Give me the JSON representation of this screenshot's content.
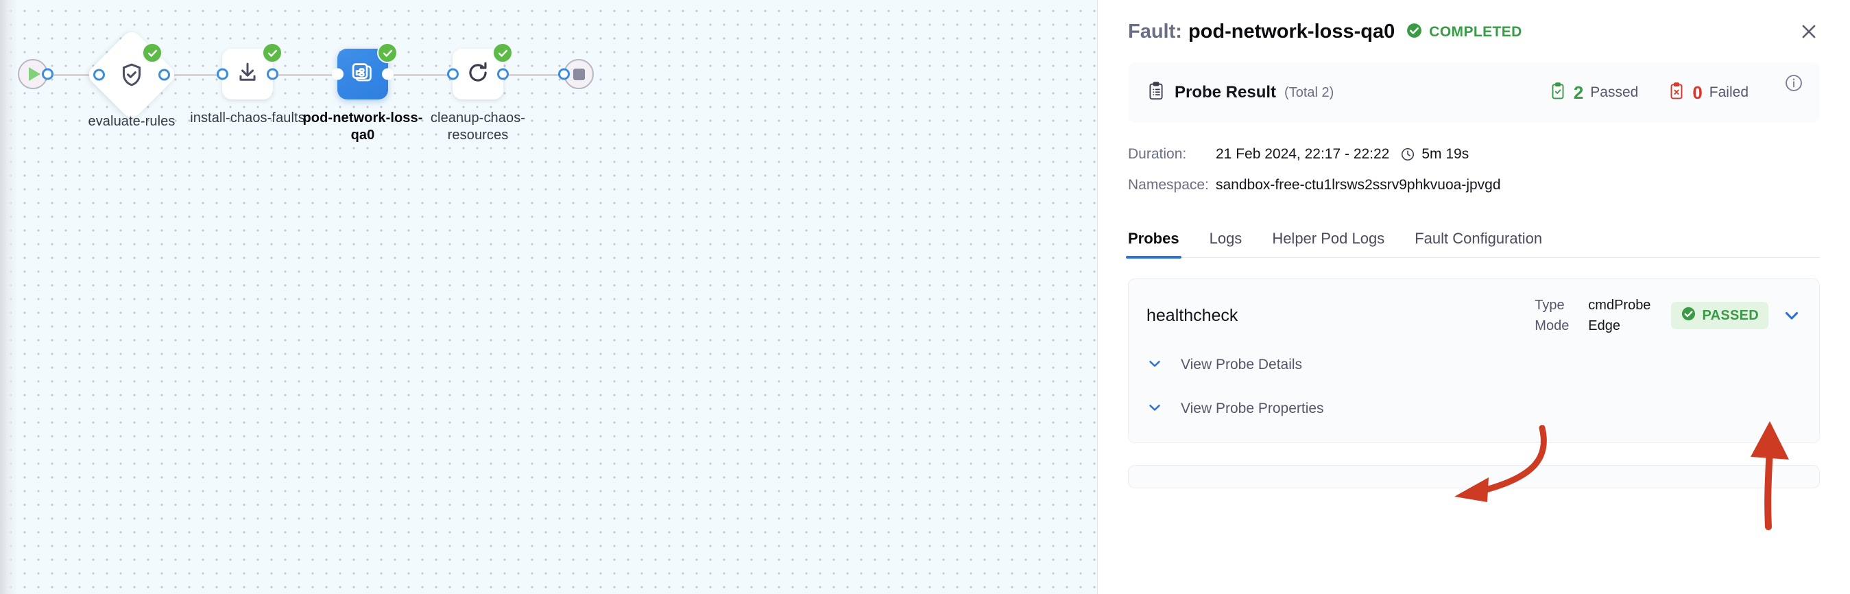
{
  "pipeline": {
    "start_node": {
      "name": "start",
      "icon": "play-icon"
    },
    "end_node": {
      "name": "end",
      "icon": "stop-icon"
    },
    "nodes": [
      {
        "label": "evaluate-rules",
        "icon": "shield-check-icon",
        "shape": "diamond",
        "status": "success",
        "selected": false
      },
      {
        "label": "install-chaos-faults",
        "icon": "download-icon",
        "shape": "square",
        "status": "success",
        "selected": false
      },
      {
        "label": "pod-network-loss-qa0",
        "icon": "chaos-fault-icon",
        "shape": "square",
        "status": "success",
        "selected": true
      },
      {
        "label": "cleanup-chaos-resources",
        "icon": "refresh-icon",
        "shape": "square",
        "status": "success",
        "selected": false
      }
    ]
  },
  "panel": {
    "header": {
      "prefix": "Fault:",
      "name": "pod-network-loss-qa0",
      "status": "COMPLETED",
      "status_color": "#3a9a45",
      "close_label": "✕"
    },
    "probe_result": {
      "title": "Probe Result",
      "total": "(Total 2)",
      "passed_count": "2",
      "passed_label": "Passed",
      "failed_count": "0",
      "failed_label": "Failed",
      "passed_color": "#3a9a45",
      "failed_color": "#d7382b"
    },
    "meta": {
      "duration_key": "Duration:",
      "duration_value": "21 Feb 2024, 22:17 - 22:22",
      "duration_elapsed": "5m 19s",
      "namespace_key": "Namespace:",
      "namespace_value": "sandbox-free-ctu1lrsws2ssrv9phkvuoa-jpvgd"
    },
    "tabs": [
      {
        "label": "Probes",
        "active": true
      },
      {
        "label": "Logs",
        "active": false
      },
      {
        "label": "Helper Pod Logs",
        "active": false
      },
      {
        "label": "Fault Configuration",
        "active": false
      }
    ],
    "probe_card": {
      "name": "healthcheck",
      "type_key": "Type",
      "type_value": "cmdProbe",
      "mode_key": "Mode",
      "mode_value": "Edge",
      "status": "PASSED",
      "status_bg": "#e4f4e3",
      "status_color": "#3a9a45",
      "details_label": "View Probe Details",
      "properties_label": "View Probe Properties"
    }
  },
  "annotations": {
    "arrow_color": "#cc3b22",
    "arrow_to_details": "curved-arrow-left",
    "arrow_to_chevron": "straight-arrow-up"
  }
}
